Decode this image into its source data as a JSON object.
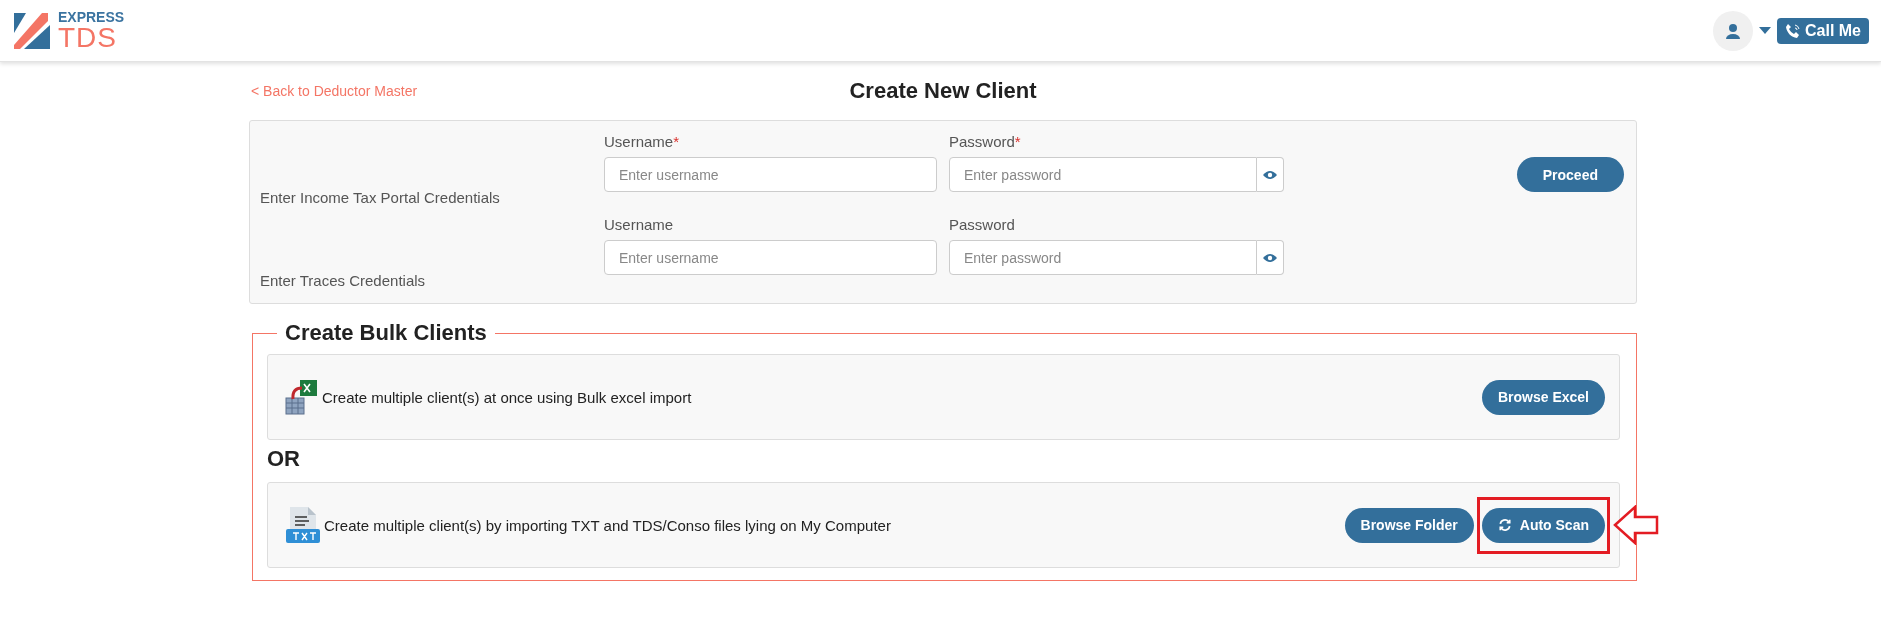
{
  "header": {
    "logo": {
      "top": "EXPRESS",
      "bottom": "TDS"
    },
    "call_button": "Call Me"
  },
  "back_link": "< Back to Deductor Master",
  "title": "Create New Client",
  "credentials": [
    {
      "label": "Enter Income Tax Portal Credentials",
      "fields": [
        {
          "label": "Username",
          "required_mark": "*",
          "placeholder": "Enter username",
          "kind": "text"
        },
        {
          "label": "Password",
          "required_mark": "*",
          "placeholder": "Enter password",
          "kind": "password"
        }
      ]
    },
    {
      "label": "Enter Traces Credentials",
      "fields": [
        {
          "label": "Username",
          "placeholder": "Enter username",
          "kind": "text"
        },
        {
          "label": "Password",
          "placeholder": "Enter password",
          "kind": "password"
        }
      ]
    }
  ],
  "proceed_button": "Proceed",
  "bulk": {
    "title": "Create Bulk Clients",
    "separator": "OR",
    "options": [
      {
        "kind": "excel",
        "text": "Create multiple client(s) at once using Bulk excel import",
        "buttons": [
          {
            "label": "Browse Excel",
            "kind": "browse",
            "highlighted": false
          }
        ]
      },
      {
        "kind": "txt",
        "text": "Create multiple client(s) by importing TXT and TDS/Conso files lying on My Computer",
        "buttons": [
          {
            "label": "Browse Folder",
            "kind": "browse",
            "highlighted": false
          },
          {
            "label": "Auto Scan",
            "kind": "scan",
            "highlighted": true
          }
        ]
      }
    ]
  }
}
